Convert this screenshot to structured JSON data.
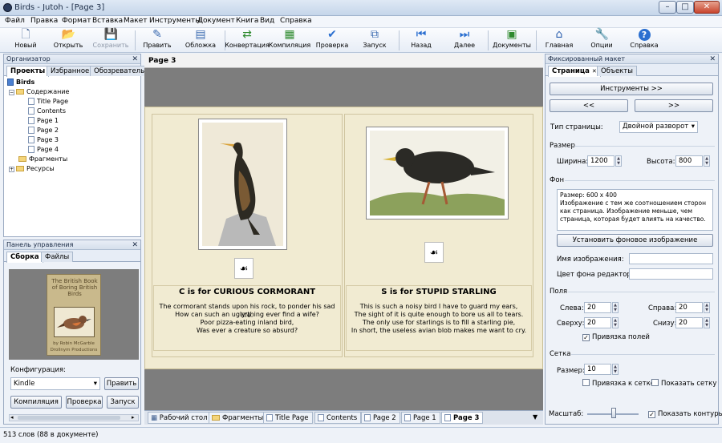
{
  "window": {
    "title": "Birds - Jutoh - [Page 3]",
    "controls": [
      "–",
      "□",
      "✕"
    ]
  },
  "menu": [
    "Файл",
    "Правка",
    "Формат",
    "Вставка",
    "Макет",
    "Инструменты",
    "Документ",
    "Книга",
    "Вид",
    "Справка"
  ],
  "toolbar": [
    {
      "label": "Новый",
      "icon": "new-page-icon",
      "glyph": "🗋",
      "color": "#3a5a8c"
    },
    {
      "label": "Открыть",
      "icon": "open-folder-icon",
      "glyph": "📂",
      "color": "#2e8a2e"
    },
    {
      "label": "Сохранить",
      "icon": "save-disk-icon",
      "glyph": "💾",
      "color": "#8a94a3",
      "disabled": true
    },
    {
      "label": "Править",
      "icon": "edit-pencil-icon",
      "glyph": "✎",
      "color": "#3a6ab0"
    },
    {
      "label": "Обложка",
      "icon": "cover-icon",
      "glyph": "▤",
      "color": "#3a6ab0"
    },
    {
      "label": "Конвертация",
      "icon": "convert-icon",
      "glyph": "⇄",
      "color": "#2e8a2e"
    },
    {
      "label": "Компиляция",
      "icon": "compile-icon",
      "glyph": "▦",
      "color": "#2e8a2e"
    },
    {
      "label": "Проверка",
      "icon": "check-icon",
      "glyph": "✔",
      "color": "#2b6fd0"
    },
    {
      "label": "Запуск",
      "icon": "launch-icon",
      "glyph": "⧉",
      "color": "#3a6ab0"
    },
    {
      "label": "Назад",
      "icon": "back-arrow-icon",
      "glyph": "⏮",
      "color": "#2b6fd0"
    },
    {
      "label": "Далее",
      "icon": "forward-arrow-icon",
      "glyph": "⏭",
      "color": "#2b6fd0"
    },
    {
      "label": "Документы",
      "icon": "documents-icon",
      "glyph": "▣",
      "color": "#2e8a2e"
    },
    {
      "label": "Главная",
      "icon": "home-icon",
      "glyph": "⌂",
      "color": "#2b5fae"
    },
    {
      "label": "Опции",
      "icon": "wrench-icon",
      "glyph": "🔧",
      "color": "#6a7788"
    },
    {
      "label": "Справка",
      "icon": "help-icon",
      "glyph": "?",
      "color": "#2b6fd0"
    }
  ],
  "organizer": {
    "title": "Организатор",
    "tabs": [
      "Проекты",
      "Избранное",
      "Обозреватель"
    ],
    "tree": [
      {
        "label": "Birds",
        "kind": "book"
      },
      {
        "label": "Содержание",
        "kind": "folder"
      },
      {
        "label": "Title Page",
        "kind": "page"
      },
      {
        "label": "Contents",
        "kind": "page"
      },
      {
        "label": "Page 1",
        "kind": "page"
      },
      {
        "label": "Page 2",
        "kind": "page"
      },
      {
        "label": "Page 3",
        "kind": "page"
      },
      {
        "label": "Page 4",
        "kind": "page"
      },
      {
        "label": "Фрагменты",
        "kind": "folder"
      },
      {
        "label": "Ресурсы",
        "kind": "folder"
      }
    ]
  },
  "control_panel": {
    "title": "Панель управления",
    "tabs": [
      "Сборка",
      "Файлы"
    ],
    "cover": {
      "title": "The British Book of Boring British Birds",
      "author": "by Robin McGarble",
      "publisher": "Drollnym Productions"
    },
    "config_label": "Конфигурация:",
    "config_value": "Kindle",
    "edit_button": "Править",
    "compile_button": "Компиляция",
    "check_button": "Проверка",
    "launch_button": "Запуск"
  },
  "editor": {
    "page_label": "Page 3",
    "left": {
      "heading": "C is for CURIOUS CORMORANT",
      "lines": [
        "The cormorant stands upon his rock, to ponder his sad life.",
        "How can such an ugly thing ever find a wife?",
        "Poor pizza-eating inland bird,",
        "Was ever a creature so absurd?"
      ]
    },
    "right": {
      "heading": "S is for STUPID STARLING",
      "lines": [
        "This is such a noisy bird I have to guard my ears,",
        "The sight of it is quite enough to bore us all to tears.",
        "The only use for starlings is to fill a starling pie,",
        "In short, the useless avian blob makes me want to cry."
      ]
    }
  },
  "bottom_tabs": [
    "Рабочий стол",
    "Фрагменты",
    "Title Page",
    "Contents",
    "Page 2",
    "Page 1",
    "Page 3"
  ],
  "layout_panel": {
    "title": "Фиксированный макет",
    "tabs": [
      "Страница",
      "Объекты"
    ],
    "tools_button": "Инструменты >>",
    "prev_button": "<<",
    "next_button": ">>",
    "page_type_label": "Тип страницы:",
    "page_type_value": "Двойной разворот",
    "size_section": "Размер",
    "width_label": "Ширина:",
    "width_value": "1200",
    "height_label": "Высота:",
    "height_value": "800",
    "background_section": "Фон",
    "background_info": "Размер: 600 x 400\nИзображение с тем же соотношением сторон как страница. Изображение меньше, чем страница, которая будет влиять на качество.",
    "set_bg_button": "Установить фоновое изображение",
    "image_name_label": "Имя изображения:",
    "editor_bg_label": "Цвет фона редактора:",
    "margins_section": "Поля",
    "left_label": "Слева:",
    "left_value": "20",
    "right_label": "Справа:",
    "right_value": "20",
    "top_label": "Сверху:",
    "top_value": "20",
    "bottom_label": "Снизу:",
    "bottom_value": "20",
    "snap_margins_label": "Привязка полей",
    "grid_section": "Сетка",
    "grid_size_label": "Размер:",
    "grid_size_value": "10",
    "snap_grid_label": "Привязка к сетке",
    "show_grid_label": "Показать сетку",
    "zoom_label": "Масштаб:",
    "show_outlines_label": "Показать контуры"
  },
  "status": "513 слов (88 в документе)"
}
